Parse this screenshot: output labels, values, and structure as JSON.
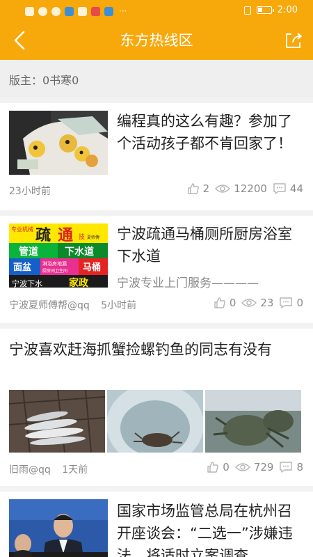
{
  "status_bar": {
    "time": "2:00",
    "left_extra": "···"
  },
  "header": {
    "title": "东方热线区"
  },
  "moderator": {
    "label": "版主：0书寒0"
  },
  "posts": [
    {
      "title": "编程真的这么有趣？参加了个活动孩子都不肯回家了！",
      "time": "23小时前",
      "likes": "2",
      "views": "12200",
      "comments": "44"
    },
    {
      "title": "宁波疏通马桶厕所厨房浴室下水道",
      "subtitle": "宁波专业上门服务————",
      "author": "宁波夏师傅帮@qq",
      "time": "5小时前",
      "likes": "0",
      "views": "23",
      "comments": "0",
      "thumb_text": {
        "top_small": "专业机械",
        "big1": "疏",
        "big2": "通",
        "tag": "技",
        "tiny": "夏师傅",
        "r2a": "管道",
        "r2b": "下水道",
        "r3a": "面盆",
        "r3b": "淋浴房地漏",
        "r3c": "厨房间卫生间",
        "r3d": "马桶",
        "r4a": "宁波下水",
        "r4b": "家政"
      }
    },
    {
      "title": "宁波喜欢赶海抓蟹捡螺钓鱼的同志有没有",
      "author": "旧雨@qq",
      "time": "1天前",
      "likes": "0",
      "views": "729",
      "comments": "8"
    },
    {
      "title": "国家市场监管总局在杭州召开座谈会：“二选一”涉嫌违法，将适时立案调查"
    }
  ],
  "colors": {
    "accent": "#f7a80b",
    "meta": "#8a8a8a"
  },
  "icons": [
    "back-arrow-icon",
    "share-icon",
    "like-icon",
    "view-eye-icon",
    "comment-icon"
  ]
}
